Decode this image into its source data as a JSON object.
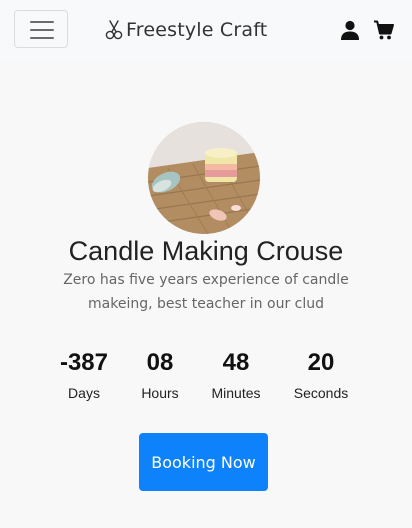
{
  "navbar": {
    "brand": "Freestyle Craft",
    "brand_icon": "scissors-icon",
    "menu_icon": "hamburger-menu-icon",
    "account_icon": "user-icon",
    "cart_icon": "cart-icon"
  },
  "course": {
    "title": "Candle Making Crouse",
    "description": "Zero has five years experience of candle makeing, best teacher in our clud"
  },
  "countdown": {
    "days": {
      "value": "-387",
      "label": "Days"
    },
    "hours": {
      "value": "08",
      "label": "Hours"
    },
    "minutes": {
      "value": "48",
      "label": "Minutes"
    },
    "seconds": {
      "value": "20",
      "label": "Seconds"
    }
  },
  "booking": {
    "button_label": "Booking Now",
    "button_color": "#0d82fb"
  }
}
